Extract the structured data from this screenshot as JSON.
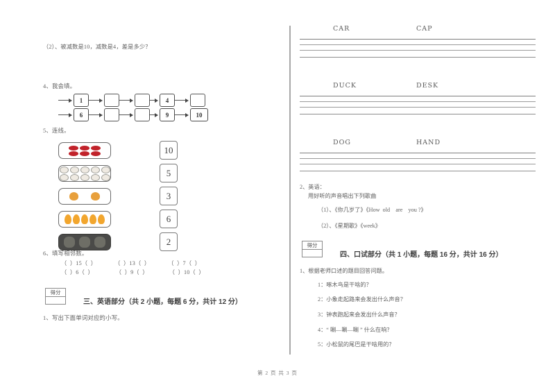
{
  "document": {
    "footer": "第 2 页 共 3 页"
  },
  "left_column": {
    "carry_over_question": "（2）、被减数是10，减数是4，差是多少？",
    "q4": {
      "label": "4、我会填。",
      "rows": [
        [
          "1",
          "",
          "",
          "4",
          ""
        ],
        [
          "6",
          "",
          "",
          "9",
          "10"
        ]
      ]
    },
    "q5": {
      "label": "5、连线。",
      "picture_boxes": [
        {
          "count": 6,
          "color": "#c62a2a",
          "shape": "grid-3x2",
          "name": "red-apples"
        },
        {
          "count": 10,
          "color": "#e8e4dd",
          "shape": "grid-5x2",
          "name": "white-sheep"
        },
        {
          "count": 2,
          "color": "#e8a03c",
          "shape": "row-2",
          "name": "orange-chicks"
        },
        {
          "count": 5,
          "color": "#f0a836",
          "shape": "row-5",
          "name": "yellow-flames"
        },
        {
          "count": 3,
          "color": "#5d5d58",
          "shape": "row-3",
          "name": "dark-monkeys"
        }
      ],
      "number_boxes": [
        "10",
        "5",
        "3",
        "6",
        "2"
      ]
    },
    "q6": {
      "label": "6、填写相邻数。",
      "rows": [
        [
          "（  ）15（  ）",
          "（  ）13（  ）",
          "（  ）7（  ）"
        ],
        [
          "（  ）6（  ）",
          "（  ）9（  ）",
          "（  ）10（  ）"
        ]
      ]
    },
    "section3": {
      "score_label": "得分",
      "title": "三、英语部分（共 2 小题，每题 6 分，共计 12 分）",
      "q1_label": "1、写出下面单词对应的小写。"
    }
  },
  "right_column": {
    "word_rows": [
      {
        "left": "CAR",
        "right": "CAP"
      },
      {
        "left": "DUCK",
        "right": "DESK"
      },
      {
        "left": "DOG",
        "right": "HAND"
      }
    ],
    "q2": {
      "label": "2、英语：",
      "instruction": "用好听的声音唱出下列歌曲",
      "songs": [
        "（1）、《你几岁了》《How  old    are    you ?》",
        "（2）、《星期歌》《week》"
      ]
    },
    "section4": {
      "score_label": "得分",
      "title": "四、口试部分（共 1 小题，每题 16 分，共计 16 分）",
      "q1_label": "1、根据老师口述的题目回答问题。",
      "questions": [
        "1：啄木鸟是干啥的？",
        "2：小象走起路来会发出什么声音？",
        "3：钟表跑起来会发出什么声音？",
        "4：“ 唰—唰—唰 ” 什么在响？",
        "5：小松鼠的尾巴是干啥用的？"
      ]
    }
  }
}
